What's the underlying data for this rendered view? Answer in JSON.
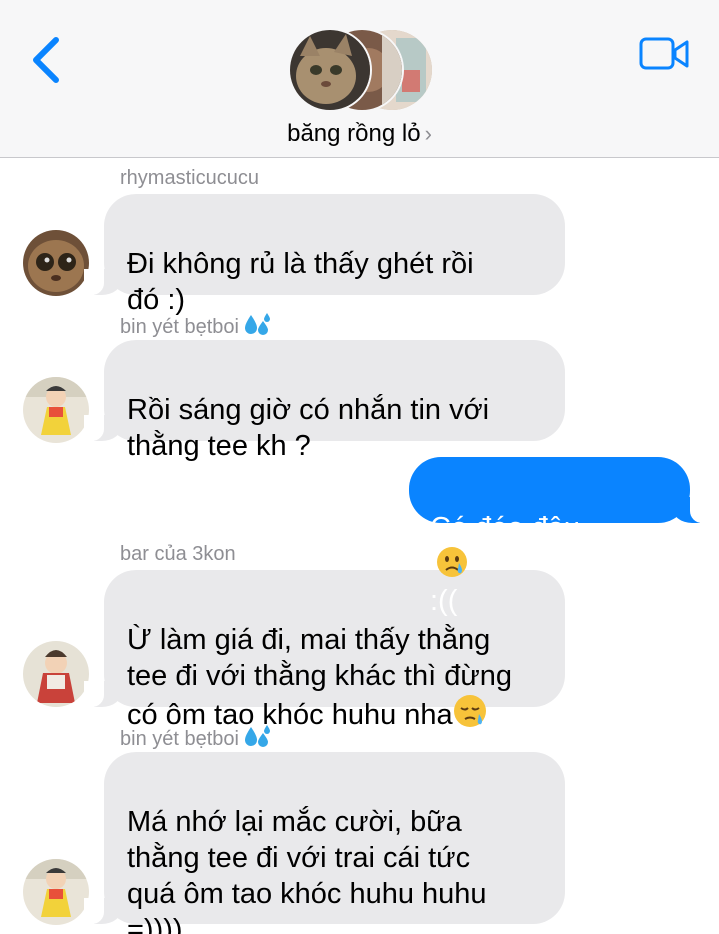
{
  "header": {
    "group_name": "băng rồng lỏ",
    "chevron": "›",
    "back_icon": "chevron-left-icon",
    "video_icon": "video-camera-icon",
    "accent_color": "#0a84ff"
  },
  "messages": [
    {
      "sender": "rhymasticucucu",
      "text": "Đi không rủ là thấy ghét rồi\nđó :)",
      "direction": "incoming",
      "avatar": "cat-photo"
    },
    {
      "sender": "bin yét bẹtboi",
      "sender_emoji": "sweat-droplets-icon",
      "text": "Rồi sáng giờ có nhắn tin với\nthằng tee kh ?",
      "direction": "incoming",
      "avatar": "cartoon-girl-yellow-dress"
    },
    {
      "text": "Có đéo đâu",
      "text_suffix": ":((",
      "emoji": "crying-face-icon",
      "direction": "outgoing"
    },
    {
      "sender": "bar của 3kon",
      "text": "Ừ làm giá đi, mai thấy thằng\ntee đi với thằng khác thì đừng\ncó ôm tao khóc huhu nha",
      "emoji": "sleepy-face-icon",
      "direction": "incoming",
      "avatar": "cartoon-woman-red-dress"
    },
    {
      "sender": "bin yét bẹtboi",
      "sender_emoji": "sweat-droplets-icon",
      "text": "Má nhớ lại mắc cười, bữa\nthằng tee đi với trai cái tức\nquá ôm tao khóc huhu huhu\n=))))",
      "direction": "incoming",
      "avatar": "cartoon-girl-yellow-dress"
    }
  ],
  "colors": {
    "incoming_bubble": "#e9e9eb",
    "outgoing_bubble": "#0a84ff",
    "sender_label": "#8e8e93"
  }
}
